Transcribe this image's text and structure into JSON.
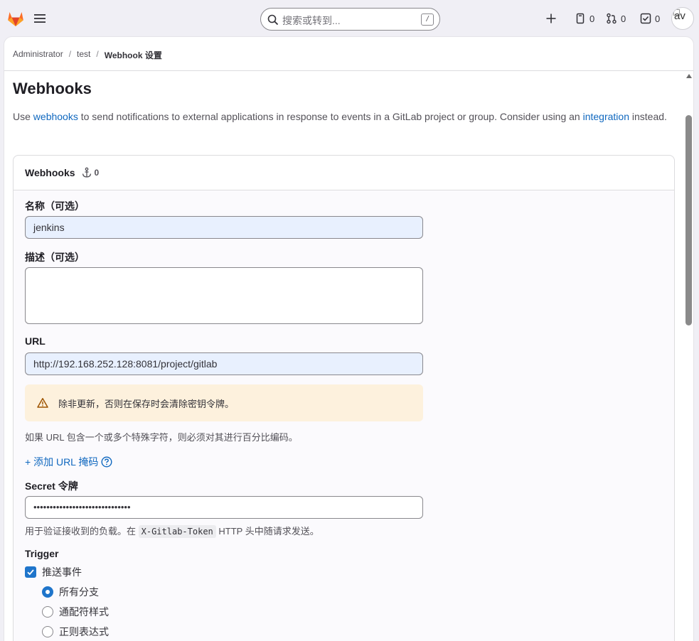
{
  "topbar": {
    "search_placeholder": "搜索或转到...",
    "search_shortcut": "/",
    "issues_count": "0",
    "merge_requests_count": "0",
    "todos_count": "0",
    "avatar_alt": "av"
  },
  "breadcrumb": {
    "items": [
      "Administrator",
      "test"
    ],
    "current": "Webhook 设置",
    "separator": "/"
  },
  "page": {
    "title": "Webhooks",
    "intro_prefix": "Use ",
    "intro_link1": "webhooks",
    "intro_middle": " to send notifications to external applications in response to events in a GitLab project or group. Consider using an ",
    "intro_link2": "integration",
    "intro_suffix": " instead."
  },
  "card": {
    "title": "Webhooks",
    "hook_count": "0"
  },
  "form": {
    "name_label": "名称（可选）",
    "name_value": "jenkins",
    "description_label": "描述（可选）",
    "url_label": "URL",
    "url_value": "http://192.168.252.128:8081/project/gitlab",
    "alert_text": "除非更新，否则在保存时会清除密钥令牌。",
    "url_help": "如果 URL 包含一个或多个特殊字符，则必须对其进行百分比编码。",
    "add_mask_label": "+ 添加 URL 掩码",
    "secret_label": "Secret 令牌",
    "secret_value": "••••••••••••••••••••••••••••••",
    "secret_help_prefix": "用于验证接收到的负载。在 ",
    "secret_help_code": "X-Gitlab-Token",
    "secret_help_suffix": " HTTP 头中随请求发送。",
    "trigger_label": "Trigger",
    "push_events_label": "推送事件",
    "branch_options": [
      "所有分支",
      "通配符样式",
      "正则表达式"
    ]
  },
  "colors": {
    "accent": "#1f75cb",
    "link": "#1068bf",
    "alert_bg": "#fdf1dd",
    "autofill_bg": "#e8f0fe"
  }
}
